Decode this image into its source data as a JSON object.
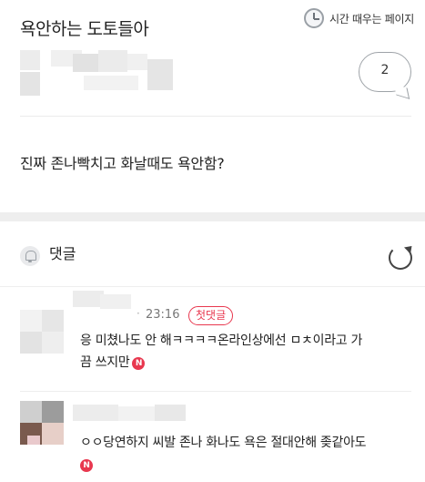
{
  "post": {
    "board_title": "욕안하는 도토들아",
    "time_kill_label": "시간 때우는 페이지",
    "comment_count": "2",
    "body": "진짜 존나빡치고 화날때도 욕안함?"
  },
  "comments_section": {
    "title": "댓글",
    "comments": [
      {
        "time": "23:16",
        "first_badge": "첫댓글",
        "text_line1": "응 미쳤나도 안 해ㅋㅋㅋㅋ온라인상에선 ㅁㅊ이라고 가",
        "text_line2": "끔 쓰지만",
        "new_badge": "N"
      },
      {
        "text_line1": "ㅇㅇ당연하지 씨발 존나 화나도 욕은 절대안해 좆같아도",
        "new_badge": "N"
      }
    ]
  },
  "colors": {
    "accent_red": "#e8384f",
    "gray_band": "#eeeeee",
    "text_primary": "#222222"
  },
  "icons": [
    "clock-icon",
    "comment-bubble-icon",
    "bell-icon",
    "refresh-icon"
  ]
}
